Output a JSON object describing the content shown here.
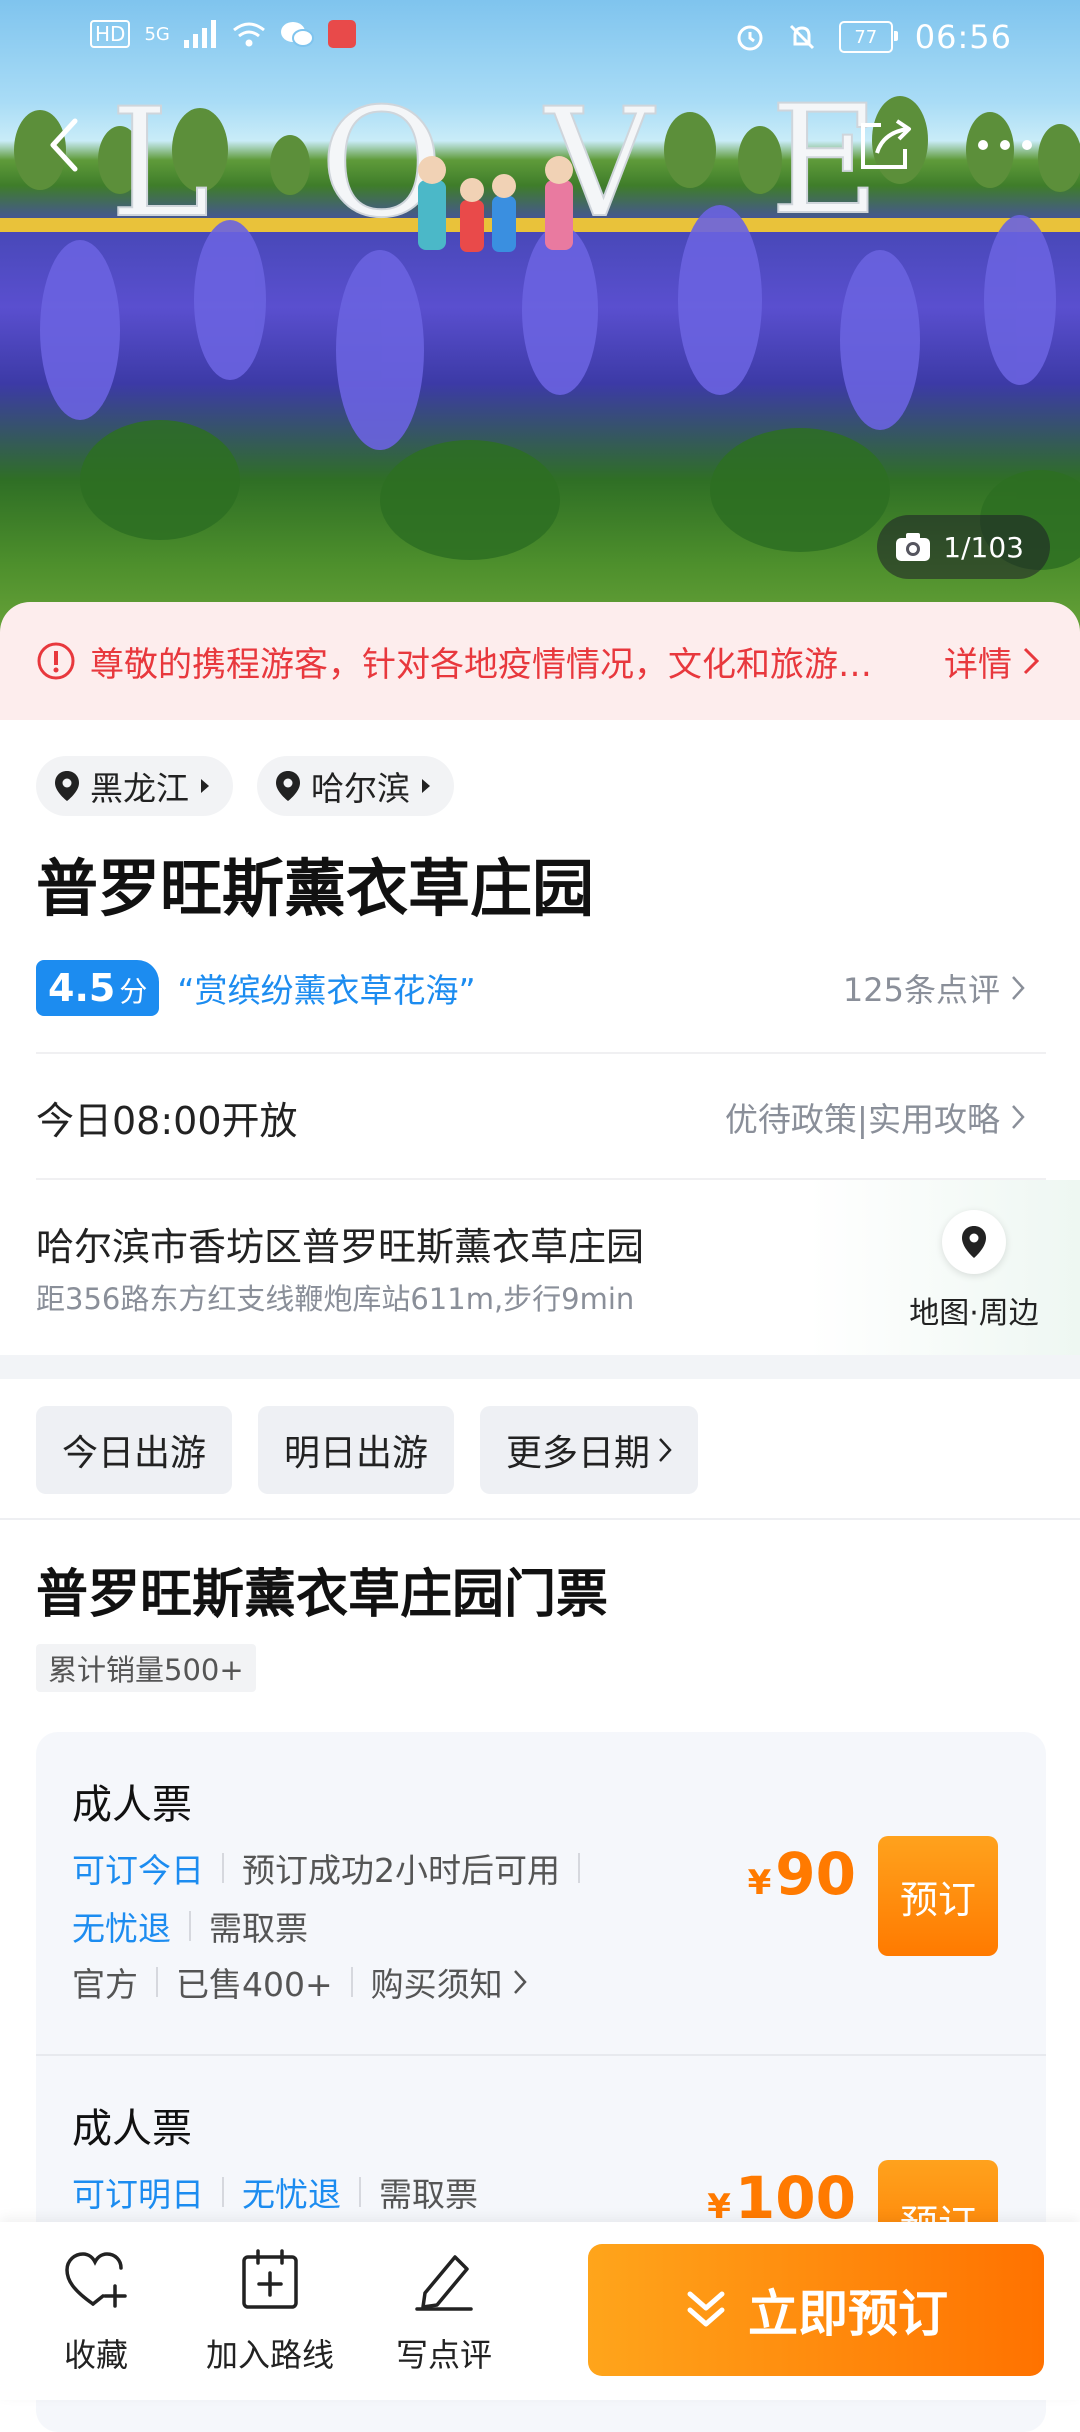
{
  "status_bar": {
    "time": "06:56",
    "network": "5G",
    "hd": "HD",
    "battery": "77"
  },
  "hero": {
    "photo_counter": "1/103",
    "sign_letters": [
      "L",
      "O",
      "V",
      "E"
    ]
  },
  "notice": {
    "text": "尊敬的携程游客，针对各地疫情情况，文化和旅游部发布相关通知",
    "more": "详情"
  },
  "tags": {
    "province": "黑龙江",
    "city": "哈尔滨"
  },
  "title": "普罗旺斯薰衣草庄园",
  "rating": {
    "score": "4.5",
    "unit": "分",
    "quote": "“赏缤纷薰衣草花海”",
    "reviews": "125条点评"
  },
  "open": {
    "text": "今日08:00开放",
    "policy": "优待政策|实用攻略"
  },
  "address": {
    "line": "哈尔滨市香坊区普罗旺斯薰衣草庄园",
    "sub": "距356路东方红支线鞭炮库站611m,步行9min",
    "map_label": "地图·周边"
  },
  "date_chips": {
    "today": "今日出游",
    "tomorrow": "明日出游",
    "more": "更多日期"
  },
  "tickets_section": {
    "title": "普罗旺斯薰衣草庄园门票",
    "sales": "累计销量500+",
    "tickets": [
      {
        "name": "成人票",
        "line1": {
          "a": "可订今日",
          "b": "预订成功2小时后可用"
        },
        "line2": {
          "a": "无忧退",
          "b": "需取票"
        },
        "line3": {
          "a": "官方",
          "b": "已售400+",
          "c": "购买须知"
        },
        "currency": "¥",
        "price": "90",
        "book": "预订"
      },
      {
        "name": "成人票",
        "line1": {
          "a": "可订明日",
          "b": "无忧退",
          "c": "需取票"
        },
        "currency": "¥",
        "price": "100",
        "book": "预订"
      }
    ]
  },
  "bottom_bar": {
    "favorite": "收藏",
    "add_route": "加入路线",
    "review": "写点评",
    "book_now": "立即预订"
  },
  "colors": {
    "accent_blue": "#1c8cf0",
    "accent_orange": "#ff7a00",
    "notice_red": "#e8383d"
  }
}
